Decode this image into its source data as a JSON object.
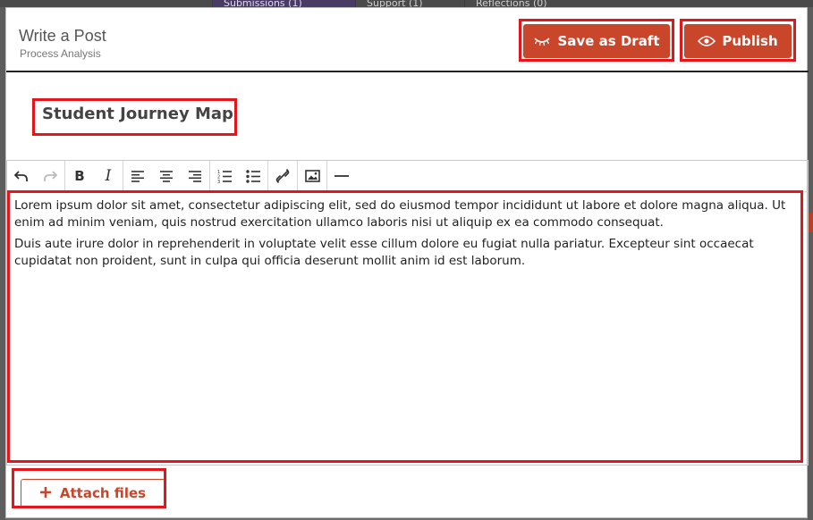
{
  "background": {
    "tabs": [
      "Submissions (1)",
      "Support (1)",
      "Reflections (0)"
    ]
  },
  "modal": {
    "title": "Write a Post",
    "subtitle": "Process Analysis",
    "buttons": {
      "save_draft": "Save as Draft",
      "publish": "Publish"
    },
    "post_title": "Student Journey Map",
    "toolbar_icons": [
      "undo-icon",
      "redo-icon",
      "bold-icon",
      "italic-icon",
      "align-left-icon",
      "align-center-icon",
      "align-right-icon",
      "numbered-list-icon",
      "bullet-list-icon",
      "link-icon",
      "image-icon",
      "horizontal-rule-icon"
    ],
    "body": {
      "paragraphs": [
        "Lorem ipsum dolor sit amet, consectetur adipiscing elit, sed do eiusmod tempor incididunt ut labore et dolore magna aliqua. Ut enim ad minim veniam, quis nostrud exercitation ullamco laboris nisi ut aliquip ex ea commodo consequat.",
        "Duis aute irure dolor in reprehenderit in voluptate velit esse cillum dolore eu fugiat nulla pariatur. Excepteur sint occaecat cupidatat non proident, sunt in culpa qui officia deserunt mollit anim id est laborum."
      ]
    },
    "attach_label": "Attach files"
  },
  "colors": {
    "accent": "#c9462b",
    "highlight": "#e4161b"
  }
}
